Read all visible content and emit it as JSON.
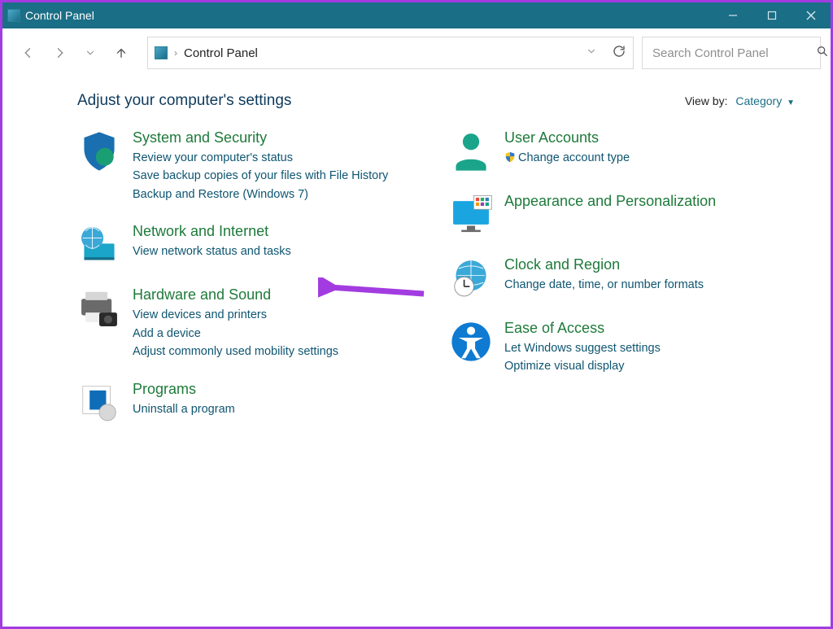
{
  "window": {
    "title": "Control Panel"
  },
  "addressbar": {
    "crumb": "Control Panel"
  },
  "search": {
    "placeholder": "Search Control Panel"
  },
  "heading": "Adjust your computer's settings",
  "viewby": {
    "label": "View by:",
    "value": "Category"
  },
  "left": {
    "system": {
      "title": "System and Security",
      "l1": "Review your computer's status",
      "l2": "Save backup copies of your files with File History",
      "l3": "Backup and Restore (Windows 7)"
    },
    "network": {
      "title": "Network and Internet",
      "l1": "View network status and tasks"
    },
    "hardware": {
      "title": "Hardware and Sound",
      "l1": "View devices and printers",
      "l2": "Add a device",
      "l3": "Adjust commonly used mobility settings"
    },
    "programs": {
      "title": "Programs",
      "l1": "Uninstall a program"
    }
  },
  "right": {
    "users": {
      "title": "User Accounts",
      "l1": "Change account type"
    },
    "appearance": {
      "title": "Appearance and Personalization"
    },
    "clock": {
      "title": "Clock and Region",
      "l1": "Change date, time, or number formats"
    },
    "ease": {
      "title": "Ease of Access",
      "l1": "Let Windows suggest settings",
      "l2": "Optimize visual display"
    }
  }
}
